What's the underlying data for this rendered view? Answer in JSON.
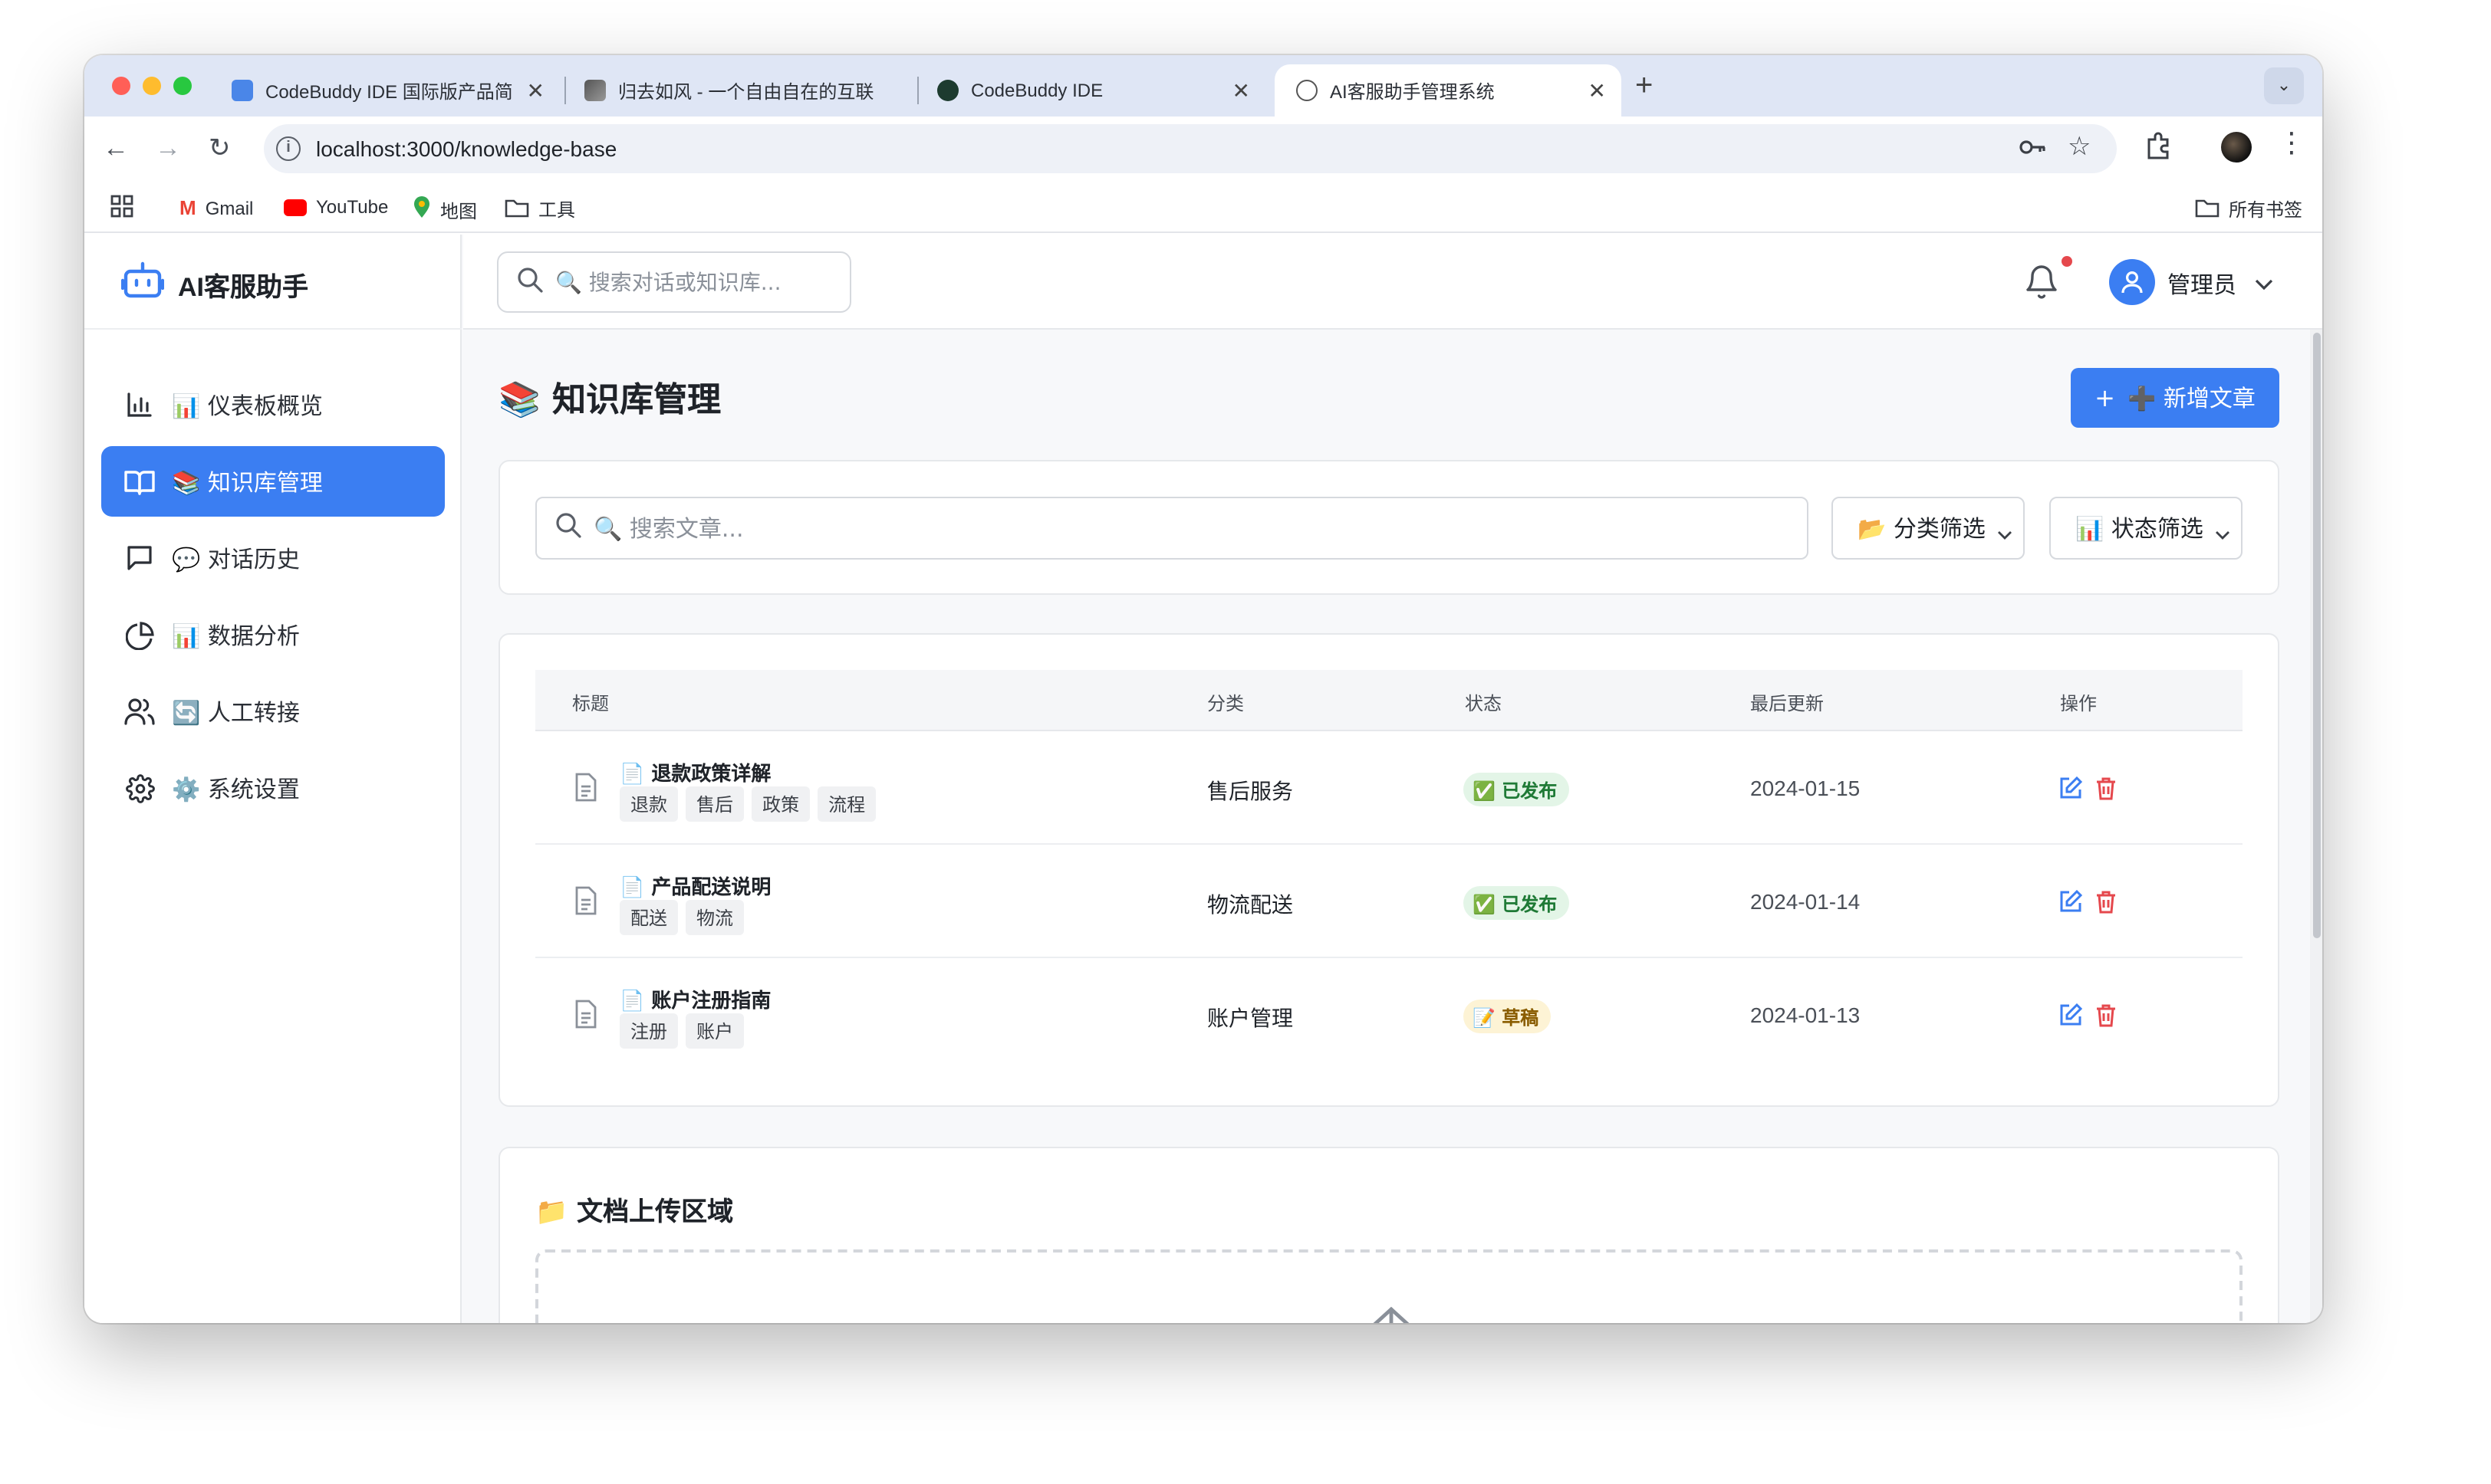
{
  "browser": {
    "tabs": [
      {
        "title": "CodeBuddy IDE 国际版产品简",
        "favicon": "doc-icon"
      },
      {
        "title": "归去如风 - 一个自由自在的互联",
        "favicon": "image-icon"
      },
      {
        "title": "CodeBuddy IDE",
        "favicon": "codebuddy-icon"
      },
      {
        "title": "AI客服助手管理系统",
        "favicon": "globe-icon",
        "active": true
      }
    ],
    "url": "localhost:3000/knowledge-base",
    "bookmarks": [
      {
        "label": "Gmail",
        "icon": "gmail-icon"
      },
      {
        "label": "YouTube",
        "icon": "youtube-icon"
      },
      {
        "label": "地图",
        "icon": "maps-icon"
      },
      {
        "label": "工具",
        "icon": "folder-icon"
      }
    ],
    "all_bookmarks": "所有书签"
  },
  "app": {
    "brand": "AI客服助手",
    "global_search_placeholder": "🔍 搜索对话或知识库...",
    "user_name": "管理员",
    "nav": [
      {
        "label": "📊 仪表板概览",
        "icon": "bar-chart-icon"
      },
      {
        "label": "📚 知识库管理",
        "icon": "book-icon",
        "active": true
      },
      {
        "label": "💬 对话历史",
        "icon": "message-icon"
      },
      {
        "label": "📊 数据分析",
        "icon": "pie-chart-icon"
      },
      {
        "label": "🔄 人工转接",
        "icon": "users-icon"
      },
      {
        "label": "⚙️ 系统设置",
        "icon": "gear-icon"
      }
    ]
  },
  "page": {
    "title": "📚 知识库管理",
    "add_button": "➕ 新增文章",
    "filters": {
      "search_placeholder": "🔍 搜索文章...",
      "category": "📂 分类筛选",
      "status": "📊 状态筛选"
    },
    "table": {
      "headers": [
        "标题",
        "分类",
        "状态",
        "最后更新",
        "操作"
      ],
      "rows": [
        {
          "title": "📄 退款政策详解",
          "tags": [
            "退款",
            "售后",
            "政策",
            "流程"
          ],
          "category": "售后服务",
          "status": "✅ 已发布",
          "status_type": "published",
          "updated": "2024-01-15"
        },
        {
          "title": "📄 产品配送说明",
          "tags": [
            "配送",
            "物流"
          ],
          "category": "物流配送",
          "status": "✅ 已发布",
          "status_type": "published",
          "updated": "2024-01-14"
        },
        {
          "title": "📄 账户注册指南",
          "tags": [
            "注册",
            "账户"
          ],
          "category": "账户管理",
          "status": "📝 草稿",
          "status_type": "draft",
          "updated": "2024-01-13"
        }
      ]
    },
    "upload": {
      "title": "📁 文档上传区域"
    }
  },
  "colors": {
    "accent": "#3b7ef2",
    "published_bg": "#e3f5e7",
    "draft_bg": "#fdf3d5",
    "delete": "#e5484d"
  }
}
